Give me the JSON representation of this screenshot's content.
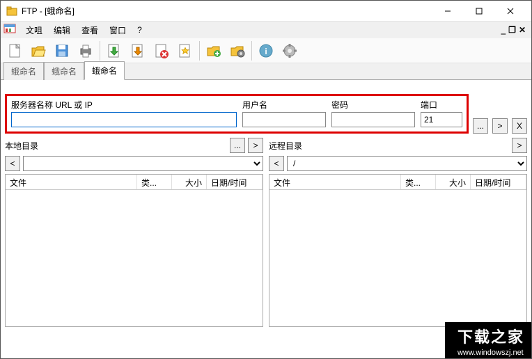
{
  "window": {
    "title": "FTP - [蛾命名]"
  },
  "menu": {
    "file": "文咀",
    "edit": "编辑",
    "view": "查看",
    "window": "窗口",
    "help": "?"
  },
  "tabs": [
    "蛾命名",
    "蛾命名",
    "蛾命名"
  ],
  "activeTab": 2,
  "conn": {
    "serverLabel": "服务器名称 URL 或 IP",
    "userLabel": "用户名",
    "passLabel": "密码",
    "portLabel": "端口",
    "server": "",
    "user": "",
    "pass": "",
    "port": "21",
    "browse": "...",
    "go": ">",
    "close": "X"
  },
  "local": {
    "label": "本地目录",
    "browse": "...",
    "go": ">",
    "back": "<",
    "path": ""
  },
  "remote": {
    "label": "远程目录",
    "go": ">",
    "back": "<",
    "path": "/"
  },
  "cols": {
    "name": "文件",
    "type": "类...",
    "size": "大小",
    "date": "日期/时间"
  },
  "watermark": {
    "text": "下载之家",
    "url": "www.windowszj.net"
  }
}
